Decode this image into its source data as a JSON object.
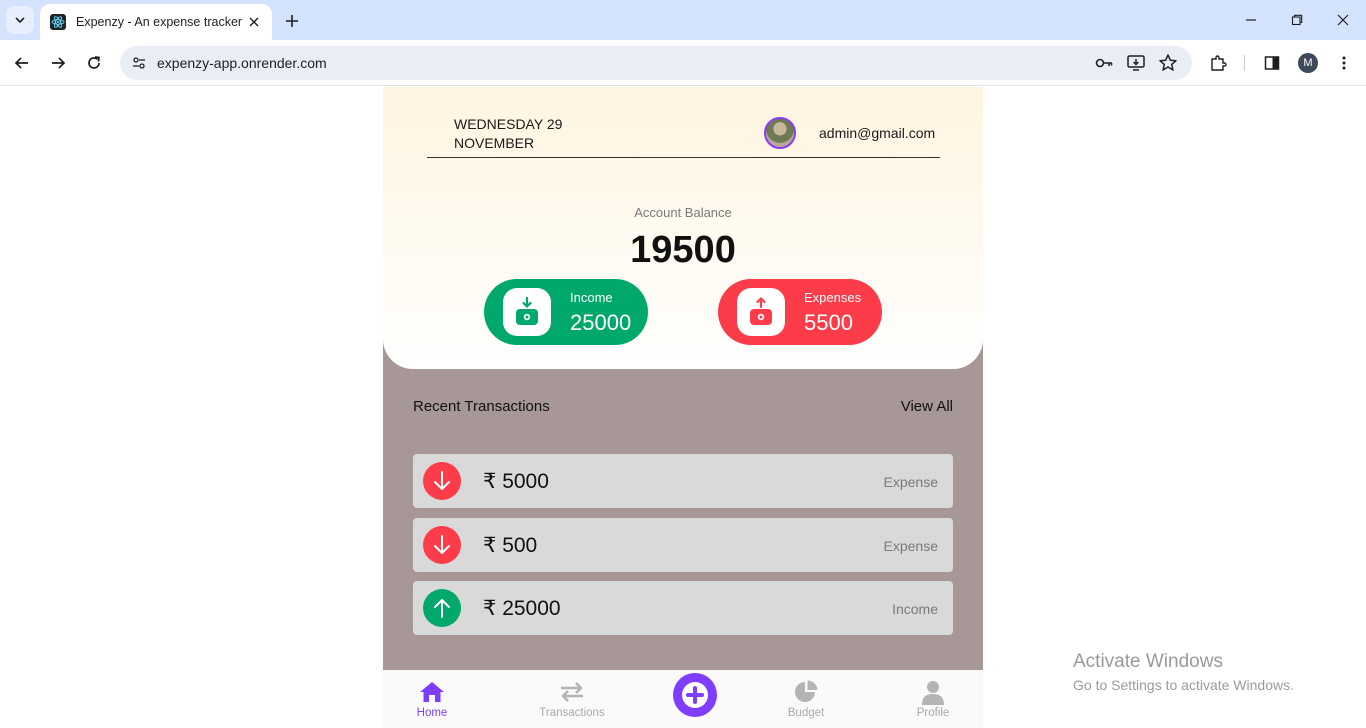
{
  "browser": {
    "tab_title": "Expenzy - An expense tracker",
    "url": "expenzy-app.onrender.com",
    "profile_initial": "M"
  },
  "header": {
    "date_line1": "WEDNESDAY 29",
    "date_line2": "NOVEMBER",
    "email": "admin@gmail.com"
  },
  "balance": {
    "label": "Account Balance",
    "value": "19500"
  },
  "summary": {
    "income": {
      "label": "Income",
      "value": "25000",
      "color": "#00a86b"
    },
    "expenses": {
      "label": "Expenses",
      "value": "5500",
      "color": "#fd3c4a"
    }
  },
  "recent": {
    "title": "Recent Transactions",
    "view_all": "View All",
    "transactions": [
      {
        "amount": "₹ 5000",
        "type": "Expense",
        "direction": "down"
      },
      {
        "amount": "₹ 500",
        "type": "Expense",
        "direction": "down"
      },
      {
        "amount": "₹ 25000",
        "type": "Income",
        "direction": "up"
      }
    ]
  },
  "bottom_nav": {
    "items": [
      {
        "label": "Home",
        "icon": "home-icon",
        "active": true
      },
      {
        "label": "Transactions",
        "icon": "transactions-icon",
        "active": false
      },
      {
        "label": "Budget",
        "icon": "pie-chart-icon",
        "active": false
      },
      {
        "label": "Profile",
        "icon": "user-icon",
        "active": false
      }
    ],
    "accent": "#7f3dff"
  },
  "watermark": {
    "title": "Activate Windows",
    "subtitle": "Go to Settings to activate Windows."
  }
}
